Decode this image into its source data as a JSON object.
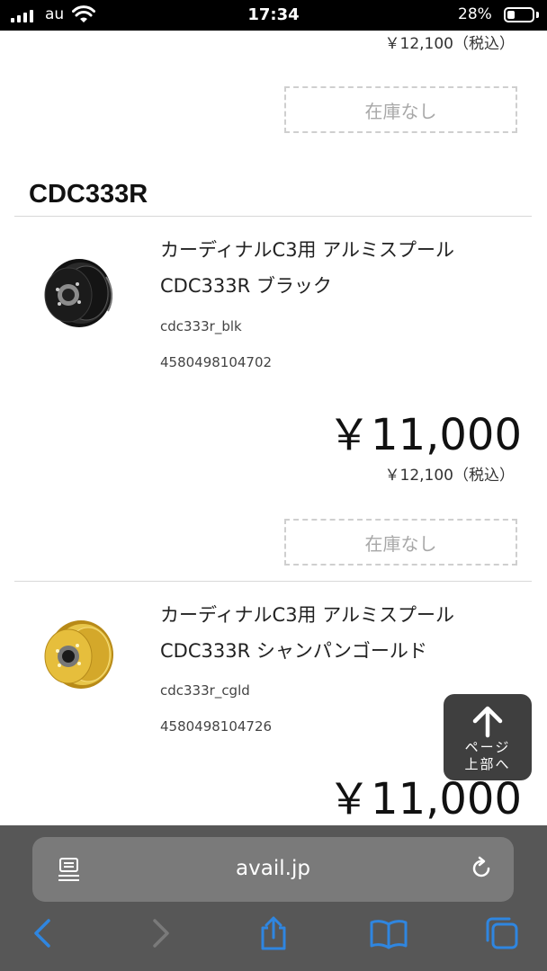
{
  "status_bar": {
    "carrier": "au",
    "time": "17:34",
    "battery": "28%"
  },
  "top_item": {
    "tax_price": "￥12,100（税込）",
    "stock_label": "在庫なし"
  },
  "section": {
    "title": "CDC333R"
  },
  "products": [
    {
      "name_line1": "カーディナルC3用 アルミスプール",
      "name_line2": "CDC333R ブラック",
      "sku": "cdc333r_blk",
      "jan": "4580498104702",
      "price": "￥11,000",
      "tax_price": "￥12,100（税込）",
      "stock_label": "在庫なし",
      "color": "#1a1a1a"
    },
    {
      "name_line1": "カーディナルC3用 アルミスプール",
      "name_line2": "CDC333R シャンパンゴールド",
      "sku": "cdc333r_cgld",
      "jan": "4580498104726",
      "price": "￥11,000",
      "color": "#d9b23a"
    }
  ],
  "back_to_top": {
    "label": "ページ\n上部へ"
  },
  "browser": {
    "url": "avail.jp",
    "accent": "#2f86e0"
  }
}
